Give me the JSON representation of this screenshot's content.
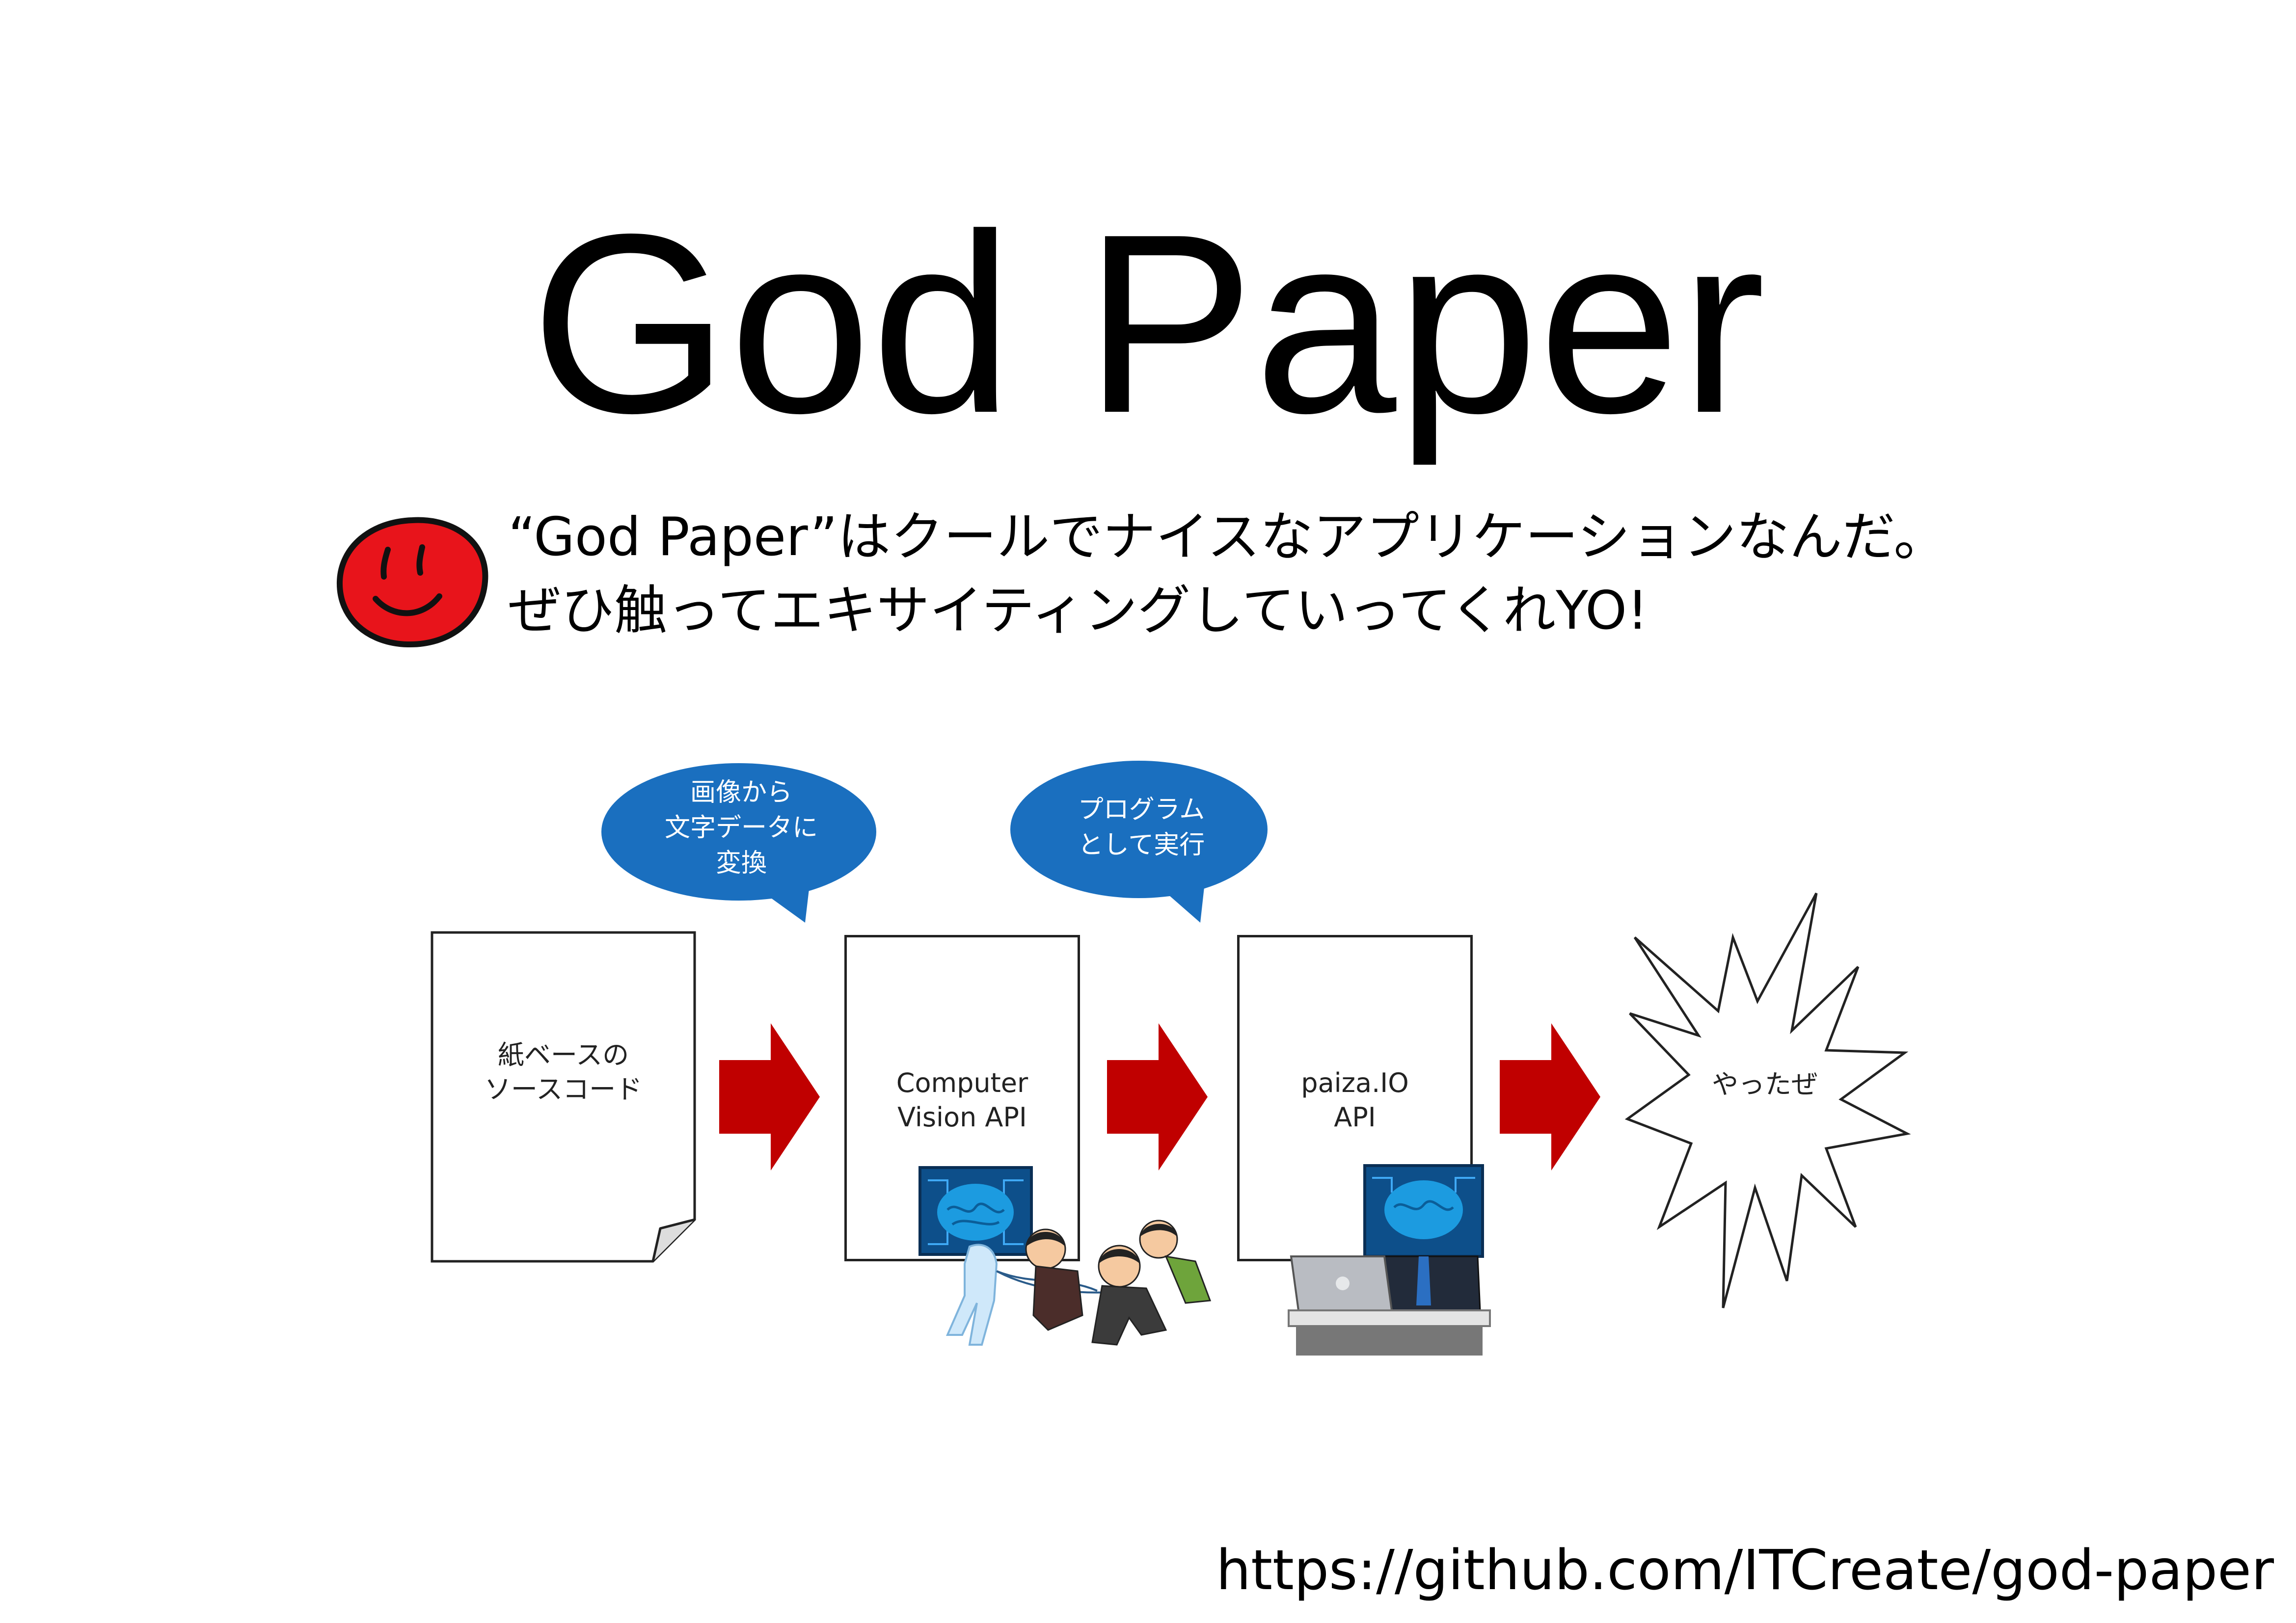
{
  "title": "God Paper",
  "subtitle": {
    "line1": "“God Paper”はクールでナイスなアプリケーションなんだ。",
    "line2": "ぜひ触ってエキサイティングしていってくれYO!"
  },
  "flow": {
    "step1": {
      "line1": "紙ベースの",
      "line2": "ソースコード"
    },
    "step2": {
      "line1": "Computer",
      "line2": "Vision API"
    },
    "step3": {
      "line1": "paiza.IO",
      "line2": "API"
    },
    "step4": {
      "label": "やったぜ"
    }
  },
  "bubbles": {
    "b1": {
      "line1": "画像から",
      "line2": "文字データに",
      "line3": "変換"
    },
    "b2": {
      "line1": "プログラム",
      "line2": "として実行"
    }
  },
  "footer": {
    "url": "https://github.com/ITCreate/god-paper"
  },
  "colors": {
    "bubble": "#1a6fbf",
    "arrow": "#c00000",
    "smiley": "#e8141b",
    "brain": "#1c9be0"
  }
}
